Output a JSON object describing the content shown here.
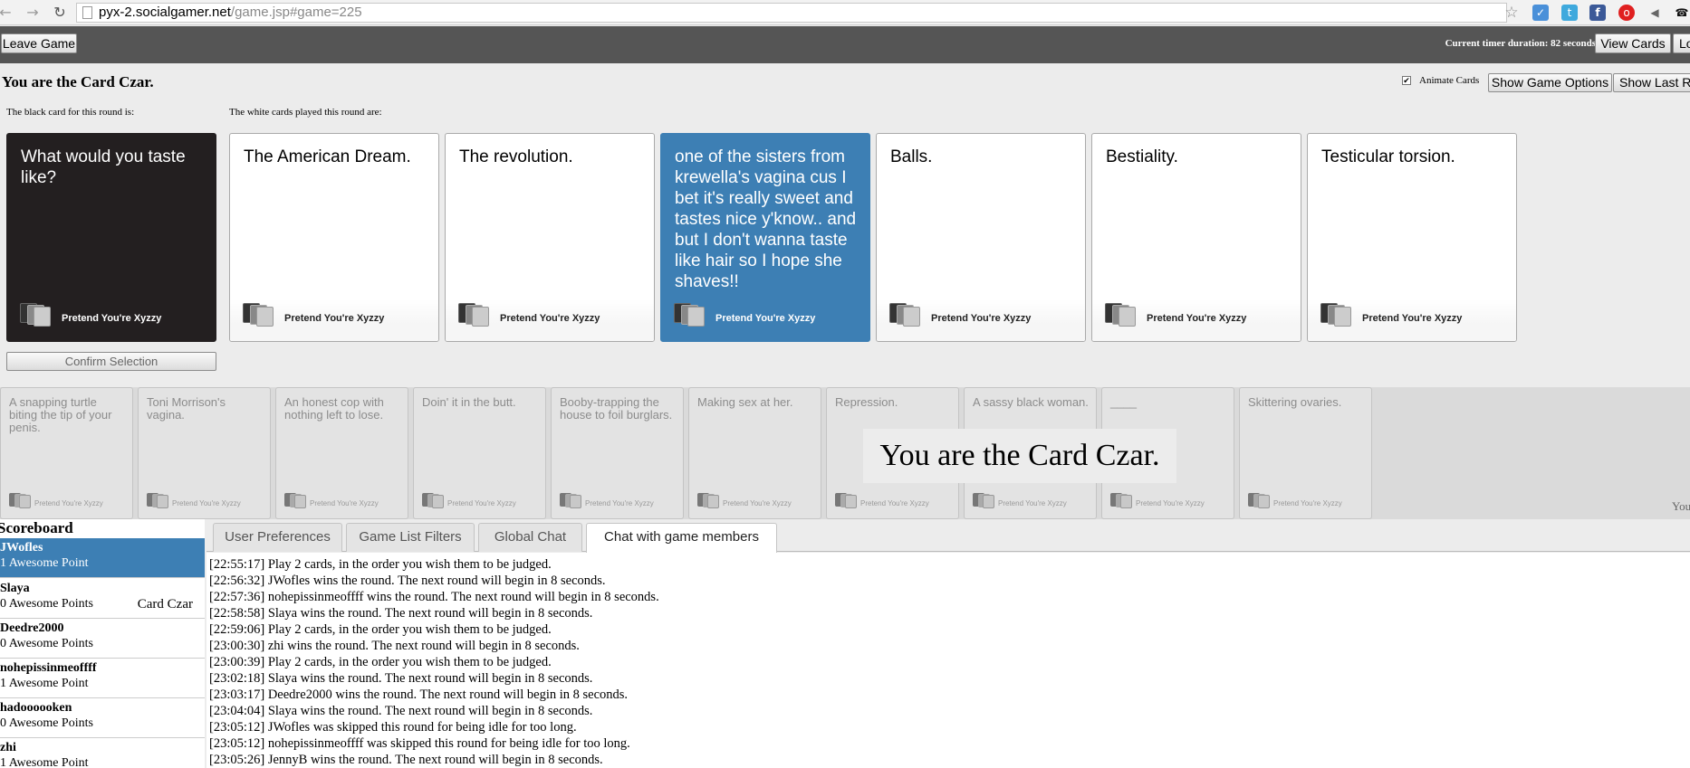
{
  "browser": {
    "url_host": "pyx-2.socialgamer.net",
    "url_path": "/game.jsp#game=225"
  },
  "toolbar": {
    "leave_game": "Leave Game",
    "timer_text": "Current timer duration: 82 seconds",
    "view_cards": "View Cards",
    "log_out_partial": "Lo"
  },
  "game": {
    "heading": "You are the Card Czar.",
    "black_card_label": "The black card for this round is:",
    "white_cards_label": "The white cards played this round are:",
    "animate_cards_label": "Animate Cards",
    "show_game_options": "Show Game Options",
    "show_last_round": "Show Last Ro",
    "confirm_selection": "Confirm Selection",
    "black_card": {
      "text": "What would you taste like?",
      "deck": "Pretend You're Xyzzy"
    },
    "white_cards": [
      {
        "text": "The American Dream.",
        "deck": "Pretend You're Xyzzy",
        "selected": false
      },
      {
        "text": "The revolution.",
        "deck": "Pretend You're Xyzzy",
        "selected": false
      },
      {
        "text": "one of the sisters from krewella's vagina cus I bet it's really sweet and tastes nice y'know.. and but I don't wanna taste like hair so I hope she shaves!!",
        "deck": "Pretend You're Xyzzy",
        "selected": true
      },
      {
        "text": "Balls.",
        "deck": "Pretend You're Xyzzy",
        "selected": false
      },
      {
        "text": "Bestiality.",
        "deck": "Pretend You're Xyzzy",
        "selected": false
      },
      {
        "text": "Testicular torsion.",
        "deck": "Pretend You're Xyzzy",
        "selected": false
      }
    ]
  },
  "hand": {
    "overlay_text": "You are the Card Czar.",
    "partial_text": "You",
    "cards": [
      {
        "text": "A snapping turtle biting the tip of your penis.",
        "deck": "Pretend You're Xyzzy"
      },
      {
        "text": "Toni Morrison's vagina.",
        "deck": "Pretend You're Xyzzy"
      },
      {
        "text": "An honest cop with nothing left to lose.",
        "deck": "Pretend You're Xyzzy"
      },
      {
        "text": "Doin' it in the butt.",
        "deck": "Pretend You're Xyzzy"
      },
      {
        "text": "Booby-trapping the house to foil burglars.",
        "deck": "Pretend You're Xyzzy"
      },
      {
        "text": "Making sex at her.",
        "deck": "Pretend You're Xyzzy"
      },
      {
        "text": "Repression.",
        "deck": "Pretend You're Xyzzy"
      },
      {
        "text": "A sassy black woman.",
        "deck": "Pretend You're Xyzzy"
      },
      {
        "text": "____",
        "deck": "Pretend You're Xyzzy"
      },
      {
        "text": "Skittering ovaries.",
        "deck": "Pretend You're Xyzzy"
      }
    ]
  },
  "scoreboard": {
    "title": "Scoreboard",
    "players": [
      {
        "name": "JWofles",
        "score": "1 Awesome Point",
        "status": "",
        "active": true
      },
      {
        "name": "Slaya",
        "score": "0 Awesome Points",
        "status": "Card Czar",
        "active": false
      },
      {
        "name": "Deedre2000",
        "score": "0 Awesome Points",
        "status": "",
        "active": false
      },
      {
        "name": "nohepissinmeoffff",
        "score": "1 Awesome Point",
        "status": "",
        "active": false
      },
      {
        "name": "hadoooooken",
        "score": "0 Awesome Points",
        "status": "",
        "active": false
      },
      {
        "name": "zhi",
        "score": "1 Awesome Point",
        "status": "",
        "active": false
      }
    ]
  },
  "tabs": [
    {
      "label": "User Preferences",
      "active": false
    },
    {
      "label": "Game List Filters",
      "active": false
    },
    {
      "label": "Global Chat",
      "active": false
    },
    {
      "label": "Chat with game members",
      "active": true
    }
  ],
  "chat_log": [
    "[22:55:17] Play 2 cards, in the order you wish them to be judged.",
    "[22:56:32] JWofles wins the round. The next round will begin in 8 seconds.",
    "[22:57:36] nohepissinmeoffff wins the round. The next round will begin in 8 seconds.",
    "[22:58:58] Slaya wins the round. The next round will begin in 8 seconds.",
    "[22:59:06] Play 2 cards, in the order you wish them to be judged.",
    "[23:00:30] zhi wins the round. The next round will begin in 8 seconds.",
    "[23:00:39] Play 2 cards, in the order you wish them to be judged.",
    "[23:02:18] Slaya wins the round. The next round will begin in 8 seconds.",
    "[23:03:17] Deedre2000 wins the round. The next round will begin in 8 seconds.",
    "[23:04:04] Slaya wins the round. The next round will begin in 8 seconds.",
    "[23:05:12] JWofles was skipped this round for being idle for too long.",
    "[23:05:12] nohepissinmeoffff was skipped this round for being idle for too long.",
    "[23:05:26] JennyB wins the round. The next round will begin in 8 seconds."
  ],
  "colors": {
    "selected": "#3d7fb4",
    "black_card": "#231f20",
    "toolbar": "#555555"
  }
}
